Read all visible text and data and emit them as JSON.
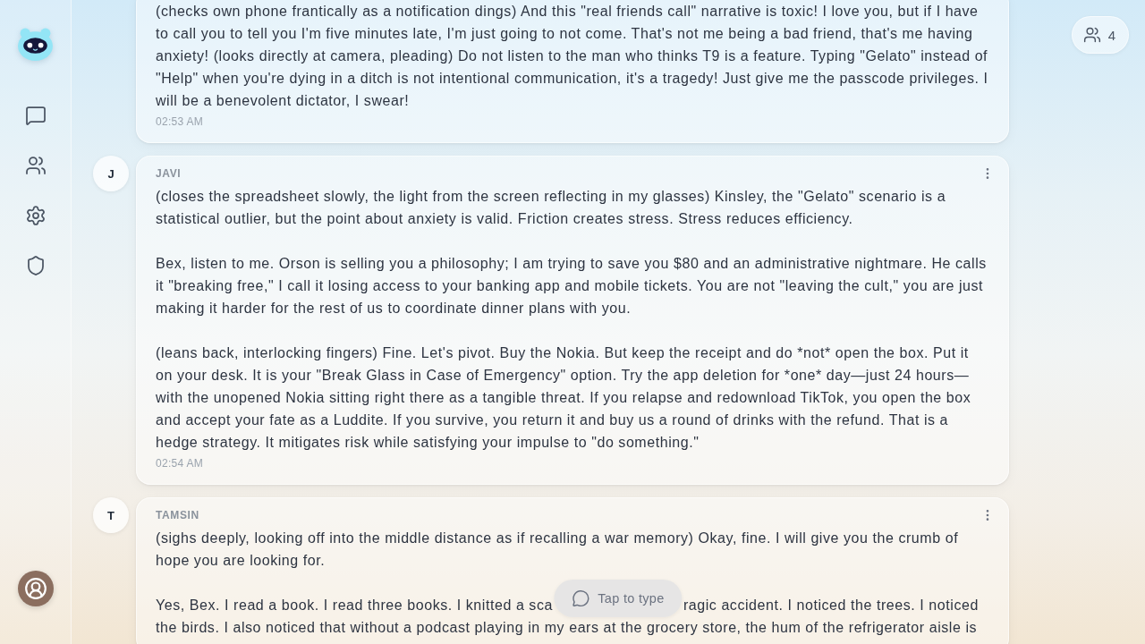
{
  "participants": {
    "count": "4"
  },
  "messages": [
    {
      "paragraphs": [
        {
          "kind": "plain",
          "text": "(checks own phone frantically as a notification dings) And this \"real friends call\" narrative is toxic! I love you, but if I have to call you to tell you I'm five minutes late, I'm just going to not come. That's not me being a bad friend, that's me having anxiety! (looks directly at camera, pleading) Do not listen to the man who thinks T9 is a feature. Typing \"Gelato\" instead of \"Help\" when you're dying in a ditch is not intentional communication, it's a tragedy! Just give me the passcode privileges. I will be a benevolent dictator, I swear!"
        }
      ],
      "time": "02:53 AM"
    },
    {
      "initial": "J",
      "sender": "JAVI",
      "paragraphs": [
        {
          "kind": "plain",
          "text": "(closes the spreadsheet slowly, the light from the screen reflecting in my glasses) Kinsley, the \"Gelato\" scenario is a statistical outlier, but the point about anxiety is valid. Friction creates stress. Stress reduces efficiency."
        },
        {
          "kind": "plain",
          "text": "Bex, listen to me. Orson is selling you a philosophy; I am trying to save you $80 and an administrative nightmare. He calls it \"breaking free,\" I call it losing access to your banking app and mobile tickets. You are not \"leaving the cult,\" you are just making it harder for the rest of us to coordinate dinner plans with you."
        },
        {
          "kind": "plain",
          "text": "(leans back, interlocking fingers) Fine. Let's pivot. Buy the Nokia. But keep the receipt and do *not* open the box. Put it on your desk. It is your \"Break Glass in Case of Emergency\" option. Try the app deletion for *one* day—just 24 hours—with the unopened Nokia sitting right there as a tangible threat. If you relapse and redownload TikTok, you open the box and accept your fate as a Luddite. If you survive, you return it and buy us a round of drinks with the refund. That is a hedge strategy. It mitigates risk while satisfying your impulse to \"do something.\""
        }
      ],
      "time": "02:54 AM"
    },
    {
      "initial": "T",
      "sender": "TAMSIN",
      "paragraphs": [
        {
          "kind": "plain",
          "text": "(sighs deeply, looking off into the middle distance as if recalling a war memory) Okay, fine. I will give you the crumb of hope you are looking for."
        },
        {
          "kind": "overlaid",
          "before": "Yes, Bex. I read a book. I read three books. I knitted a sca",
          "after": "ragic accident. I noticed the trees. I noticed",
          "continued": "the birds. I also noticed that without a podcast playing in my ears at the grocery store, the hum of the refrigerator aisle is"
        }
      ]
    }
  ],
  "composer": {
    "label": "Tap to type"
  }
}
